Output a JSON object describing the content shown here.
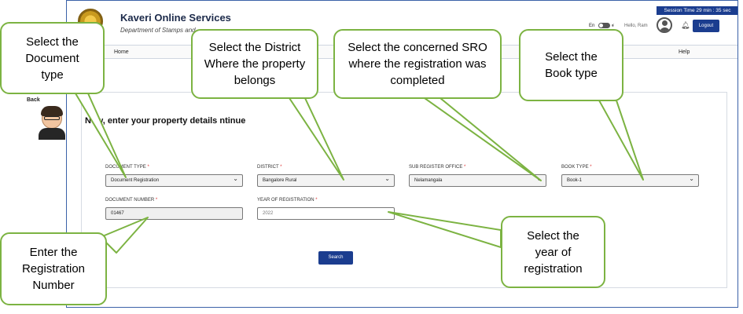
{
  "header": {
    "app_title": "Kaveri Online Services",
    "app_subtitle": "Department of Stamps and",
    "lang_en": "En",
    "lang_kn": "ಕ",
    "hello": "Hello, Ram",
    "logout": "Logout",
    "session": "Session Time 29 min : 35 sec"
  },
  "nav": {
    "home": "Home",
    "help": "Help"
  },
  "page": {
    "back": "Back",
    "headline": "Now, enter your property details   ntinue"
  },
  "form": {
    "document_type": {
      "label": "DOCUMENT TYPE",
      "value": "Document Registration"
    },
    "district": {
      "label": "DISTRICT",
      "value": "Bangalore Rural"
    },
    "sro": {
      "label": "SUB REGISTER OFFICE",
      "value": "Nelamangala"
    },
    "book_type": {
      "label": "BOOK TYPE",
      "value": "Book-1"
    },
    "document_number": {
      "label": "DOCUMENT NUMBER",
      "value": "01467"
    },
    "year": {
      "label": "YEAR OF REGISTRATION",
      "value": "2022"
    },
    "required_mark": "*",
    "search": "Search"
  },
  "callouts": {
    "doc_type": "Select the Document type",
    "district": "Select the District Where the property belongs",
    "sro": "Select the concerned SRO where the registration was completed",
    "book": "Select the Book type",
    "reg_number": "Enter the Registration Number",
    "year": "Select the year of registration"
  },
  "colors": {
    "brand": "#1b3d8f",
    "callout_border": "#7cb342"
  }
}
